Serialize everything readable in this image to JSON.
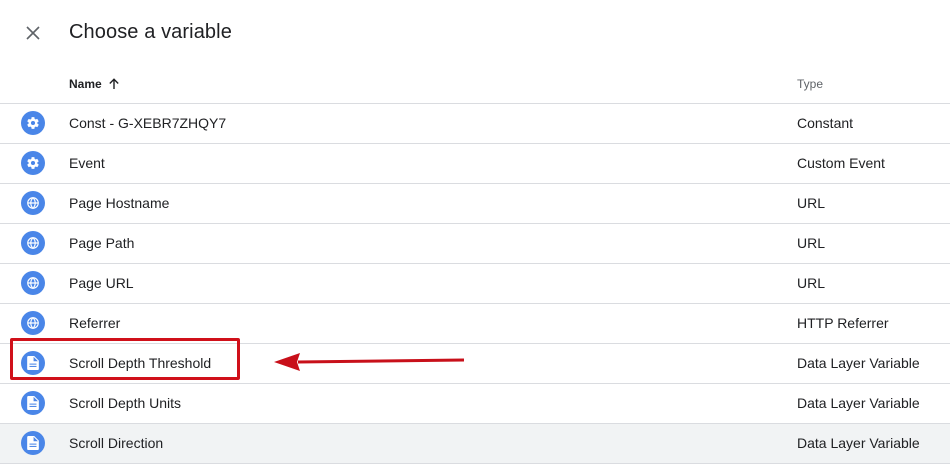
{
  "dialog": {
    "title": "Choose a variable",
    "close_icon": "close-icon"
  },
  "columns": {
    "name_label": "Name",
    "sort_icon": "arrow-up-icon",
    "type_label": "Type"
  },
  "variables": [
    {
      "name": "Const - G-XEBR7ZHQY7",
      "type": "Constant",
      "icon": "gear-icon"
    },
    {
      "name": "Event",
      "type": "Custom Event",
      "icon": "gear-icon"
    },
    {
      "name": "Page Hostname",
      "type": "URL",
      "icon": "globe-icon"
    },
    {
      "name": "Page Path",
      "type": "URL",
      "icon": "globe-icon"
    },
    {
      "name": "Page URL",
      "type": "URL",
      "icon": "globe-icon"
    },
    {
      "name": "Referrer",
      "type": "HTTP Referrer",
      "icon": "globe-icon"
    },
    {
      "name": "Scroll Depth Threshold",
      "type": "Data Layer Variable",
      "icon": "document-icon"
    },
    {
      "name": "Scroll Depth Units",
      "type": "Data Layer Variable",
      "icon": "document-icon"
    },
    {
      "name": "Scroll Direction",
      "type": "Data Layer Variable",
      "icon": "document-icon"
    }
  ],
  "annotation": {
    "highlighted_row": "Scroll Depth Threshold",
    "color": "#d0101a"
  },
  "colors": {
    "icon_background": "#4a86e8",
    "divider": "#dadce0"
  }
}
